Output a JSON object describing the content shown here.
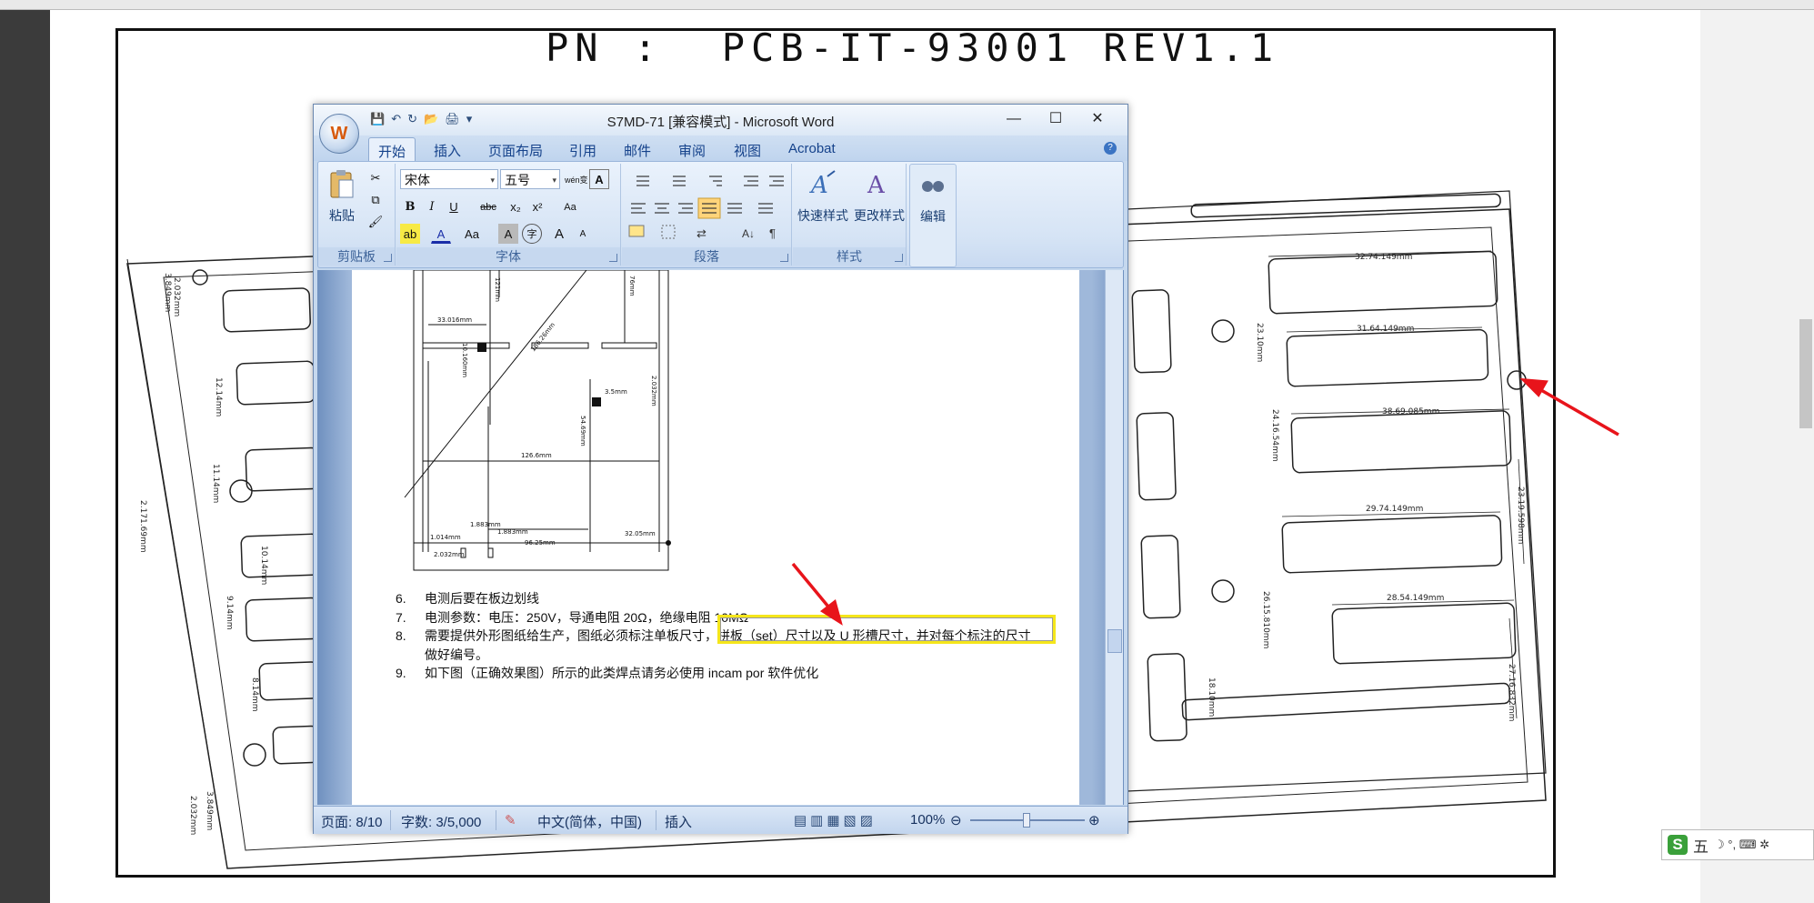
{
  "drawing": {
    "part_number": "PN :  PCB-IT-93001 REV1.1",
    "dim_labels": {
      "d1": "32.74.149mm",
      "d2": "31.64.149mm",
      "d3": "38.69.085mm",
      "d4": "29.74.149mm",
      "d5": "28.54.149mm",
      "d6": "23.10mm",
      "d7": "24.16.54mm",
      "d8": "23.19.598mm",
      "d9": "26.15.810mm",
      "d10": "27.16.832mm",
      "d11": "18.10mm",
      "d12": "2.032mm",
      "d13": "3.849mm",
      "d14": "12.14mm",
      "d15": "11.14mm",
      "d16": "2.171.69mm",
      "d17": "10.14mm",
      "d18": "9.14mm",
      "d19": "8.14mm",
      "d20": "2.032mm",
      "d21": "3.849mm"
    }
  },
  "word": {
    "title": "S7MD-71 [兼容模式] - Microsoft Word",
    "office_button": "W",
    "qat": [
      "💾",
      "↶",
      "↻",
      "📂",
      "🖨",
      "▾"
    ],
    "window_controls": {
      "minimize": "—",
      "maximize": "☐",
      "close": "✕"
    },
    "tabs": [
      "开始",
      "插入",
      "页面布局",
      "引用",
      "邮件",
      "审阅",
      "视图",
      "Acrobat"
    ],
    "help": "?",
    "ribbon": {
      "clipboard": {
        "label": "剪贴板",
        "paste": "粘贴",
        "cut": "✂",
        "copy": "⧉",
        "format_painter": "🖌"
      },
      "font": {
        "label": "字体",
        "font_name": "宋体",
        "font_size": "五号",
        "wen": "wén变",
        "a_box": "A",
        "bold": "B",
        "italic": "I",
        "underline": "U",
        "strike": "abc",
        "subscript": "x₂",
        "superscript": "x²",
        "clear": "Aa",
        "highlight": "ab",
        "font_color": "A",
        "change_case": "Aa",
        "char_shading": "A",
        "enclose": "字",
        "grow": "A",
        "shrink": "A"
      },
      "paragraph": {
        "label": "段落"
      },
      "styles": {
        "label": "样式",
        "quick_styles": "快速样式",
        "change_styles": "更改样式"
      },
      "editing": {
        "label": "编辑"
      }
    },
    "doc": {
      "figure_labels": [
        "33.016mm",
        "10.160mm",
        "126.6mm",
        "3.5mm",
        "2.032mm",
        "54.69mm",
        "32.05mm",
        "1.883mm",
        "1.883mm",
        "96.25mm",
        "2.032mm",
        "186.26mm",
        "121mm",
        "76mm",
        "1.014mm"
      ],
      "items": [
        {
          "num": "6.",
          "text": "电测后要在板边划线"
        },
        {
          "num": "7.",
          "text": "电测参数：电压：250V，导通电阻 20Ω，绝缘电阻 10MΩ"
        },
        {
          "num": "8.",
          "text": "需要提供外形图纸给生产，图纸必须标注单板尺寸，拼板（set）尺寸以及 U 形槽尺寸，并对每个标注的尺寸"
        },
        {
          "num": "",
          "text": "做好编号。"
        },
        {
          "num": "9.",
          "text": "如下图（正确效果图）所示的此类焊点请务必使用 incam por 软件优化"
        }
      ]
    },
    "status": {
      "page": "页面: 8/10",
      "words": "字数: 3/5,000",
      "lang": "中文(简体，中国)",
      "mode": "插入",
      "zoom": "100%"
    }
  },
  "ime": {
    "logo": "S",
    "mode": "五",
    "symbols": "☽ °, ⌨ ✲"
  },
  "colors": {
    "arrow": "#e8141b",
    "highlight_box": "#f5e61b"
  }
}
